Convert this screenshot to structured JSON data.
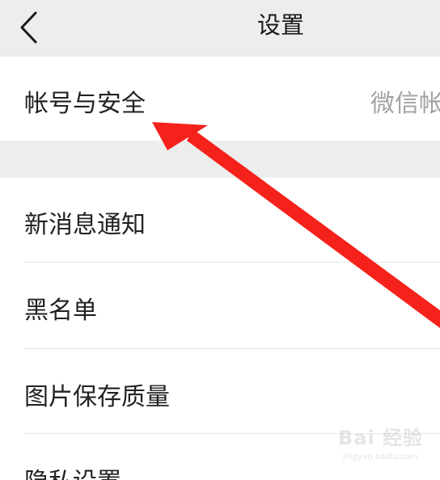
{
  "header": {
    "title": "设置",
    "back_icon": "chevron-left-icon"
  },
  "settings": {
    "items": [
      {
        "label": "帐号与安全",
        "value": "微信帐"
      },
      {
        "label": "新消息通知"
      },
      {
        "label": "黑名单"
      },
      {
        "label": "图片保存质量"
      },
      {
        "label": "隐私设置"
      }
    ]
  },
  "annotation": {
    "arrow_color": "#f5221c"
  },
  "watermark": {
    "logo_text": "Bai 经验",
    "url": "jingyan.baidu.com"
  },
  "colors": {
    "header_bg": "#ededed",
    "section_gap": "#ededed",
    "value_text": "#a3a3a3",
    "label_text": "#222222"
  }
}
